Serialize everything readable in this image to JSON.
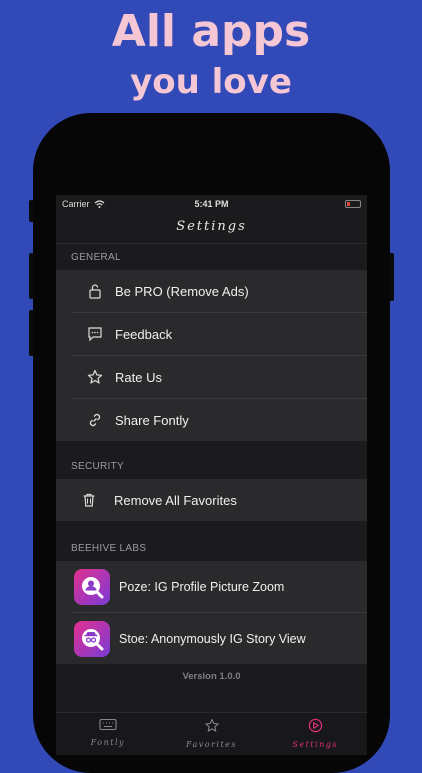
{
  "promo": {
    "line1": "All apps",
    "line2": "you love"
  },
  "status_bar": {
    "carrier": "Carrier",
    "time": "5:41 PM"
  },
  "nav": {
    "title": "Settings"
  },
  "general": {
    "header": "GENERAL",
    "items": [
      {
        "label": "Be PRO (Remove Ads)",
        "icon": "unlock-icon"
      },
      {
        "label": "Feedback",
        "icon": "message-icon"
      },
      {
        "label": "Rate Us",
        "icon": "star-icon"
      },
      {
        "label": "Share Fontly",
        "icon": "link-icon"
      }
    ]
  },
  "security": {
    "header": "SECURITY",
    "items": [
      {
        "label": "Remove All Favorites",
        "icon": "trash-icon"
      }
    ]
  },
  "labs": {
    "header": "BEEHIVE LABS",
    "items": [
      {
        "label": "Poze: IG Profile Picture Zoom",
        "icon": "poze-app-icon"
      },
      {
        "label": "Stoe: Anonymously IG Story View",
        "icon": "stoe-app-icon"
      }
    ]
  },
  "version": "Version 1.0.0",
  "tabs": [
    {
      "label": "Fontly",
      "icon": "keyboard-icon"
    },
    {
      "label": "Favorites",
      "icon": "star-icon"
    },
    {
      "label": "Settings",
      "icon": "settings-icon"
    }
  ],
  "colors": {
    "background": "#3249b8",
    "headline": "#f5c6d4",
    "accent": "#e2307b"
  }
}
